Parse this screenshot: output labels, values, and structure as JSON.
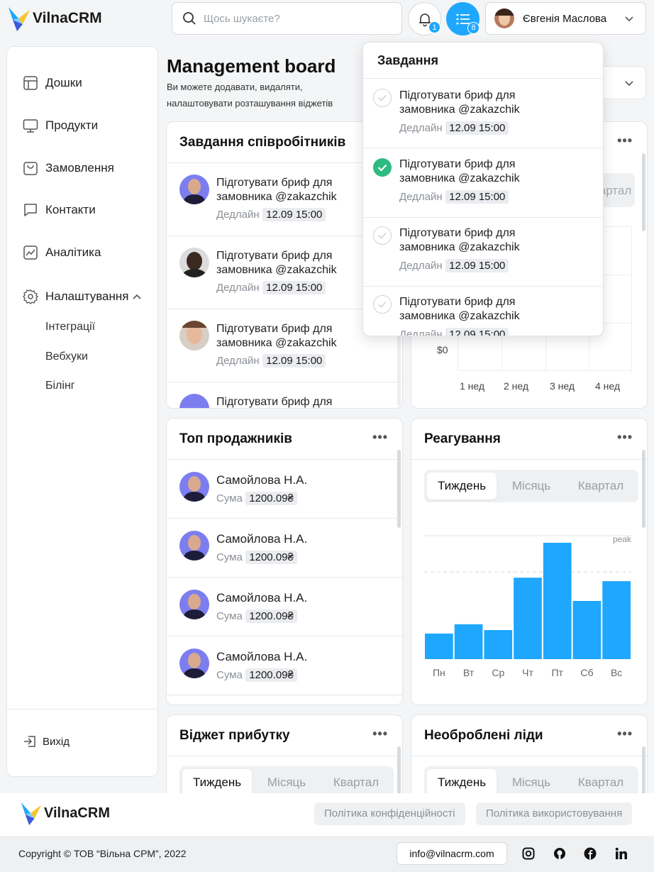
{
  "app": {
    "name": "VilnaCRM"
  },
  "header": {
    "search_placeholder": "Щось шукаєте?",
    "notifications_count": "1",
    "tasks_count": "8",
    "user_name": "Євгенія Маслова"
  },
  "sidebar": {
    "items": [
      {
        "label": "Дошки",
        "icon": "board-icon"
      },
      {
        "label": "Продукти",
        "icon": "monitor-icon"
      },
      {
        "label": "Замовлення",
        "icon": "bag-icon"
      },
      {
        "label": "Контакти",
        "icon": "chat-icon"
      },
      {
        "label": "Аналітика",
        "icon": "chart-icon"
      },
      {
        "label": "Налаштування",
        "icon": "gear-icon"
      }
    ],
    "subitems": [
      "Інтеграції",
      "Вебхуки",
      "Білінг"
    ],
    "logout": "Вихід"
  },
  "page": {
    "title": "Management board",
    "subtitle_line1": "Ви можете додавати, видаляти,",
    "subtitle_line2": "налаштовувати розташування віджетів"
  },
  "tasks_widget": {
    "title": "Завдання співробітників",
    "items": [
      {
        "line1": "Підготувати бриф для",
        "line2": "замовника @zakazchik",
        "deadline_label": "Дедлайн",
        "date": "12.09 15:00"
      },
      {
        "line1": "Підготувати бриф для",
        "line2": "замовника @zakazchik",
        "deadline_label": "Дедлайн",
        "date": "12.09 15:00"
      },
      {
        "line1": "Підготувати бриф для",
        "line2": "замовника @zakazchik",
        "deadline_label": "Дедлайн",
        "date": "12.09 15:00"
      },
      {
        "line1": "Підготувати бриф для"
      }
    ]
  },
  "dropdown": {
    "title": "Завдання",
    "items": [
      {
        "line1": "Підготувати бриф для",
        "line2": "замовника @zakazchik",
        "deadline_label": "Дедлайн",
        "date": "12.09 15:00",
        "done": false
      },
      {
        "line1": "Підготувати бриф для",
        "line2": "замовника @zakazchik",
        "deadline_label": "Дедлайн",
        "date": "12.09 15:00",
        "done": true
      },
      {
        "line1": "Підготувати бриф для",
        "line2": "замовника @zakazchik",
        "deadline_label": "Дедлайн",
        "date": "12.09 15:00",
        "done": false
      },
      {
        "line1": "Підготувати бриф для",
        "line2": "замовника @zakazchik",
        "deadline_label": "Дедлайн",
        "date": "12.09 15:00",
        "done": false
      }
    ]
  },
  "hidden_chart": {
    "tab_visible": "Квартал",
    "ytick": "$0",
    "weeks": [
      "1 нед",
      "2 нед",
      "3 нед",
      "4 нед"
    ]
  },
  "top_sellers": {
    "title": "Топ продажників",
    "items": [
      {
        "name": "Самойлова Н.А.",
        "label": "Сума",
        "amount": "1200.09₴"
      },
      {
        "name": "Самойлова Н.А.",
        "label": "Сума",
        "amount": "1200.09₴"
      },
      {
        "name": "Самойлова Н.А.",
        "label": "Сума",
        "amount": "1200.09₴"
      },
      {
        "name": "Самойлова Н.А.",
        "label": "Сума",
        "amount": "1200.09₴"
      }
    ]
  },
  "reaction": {
    "title": "Реагування",
    "tabs": [
      "Тиждень",
      "Місяць",
      "Квартал"
    ],
    "peak_label": "peak"
  },
  "chart_data": {
    "type": "bar",
    "categories": [
      "Пн",
      "Вт",
      "Ср",
      "Чт",
      "Пт",
      "Сб",
      "Вс"
    ],
    "values": [
      22,
      30,
      25,
      70,
      100,
      50,
      67
    ],
    "ylim": [
      0,
      100
    ],
    "peak_line": 75,
    "colors": {
      "bar": "#1ea7fd"
    }
  },
  "profit_widget": {
    "title": "Віджет прибутку",
    "tabs": [
      "Тиждень",
      "Місяць",
      "Квартал"
    ]
  },
  "leads_widget": {
    "title": "Необроблені ліди",
    "tabs": [
      "Тиждень",
      "Місяць",
      "Квартал"
    ]
  },
  "footer": {
    "privacy": "Політика конфіденційності",
    "terms": "Політика використовування",
    "copyright": "Copyright © ТОВ “Вільна СРМ”, 2022",
    "email": "info@vilnacrm.com"
  },
  "colors": {
    "accent": "#1ea7fd",
    "success": "#2dbb7f"
  }
}
